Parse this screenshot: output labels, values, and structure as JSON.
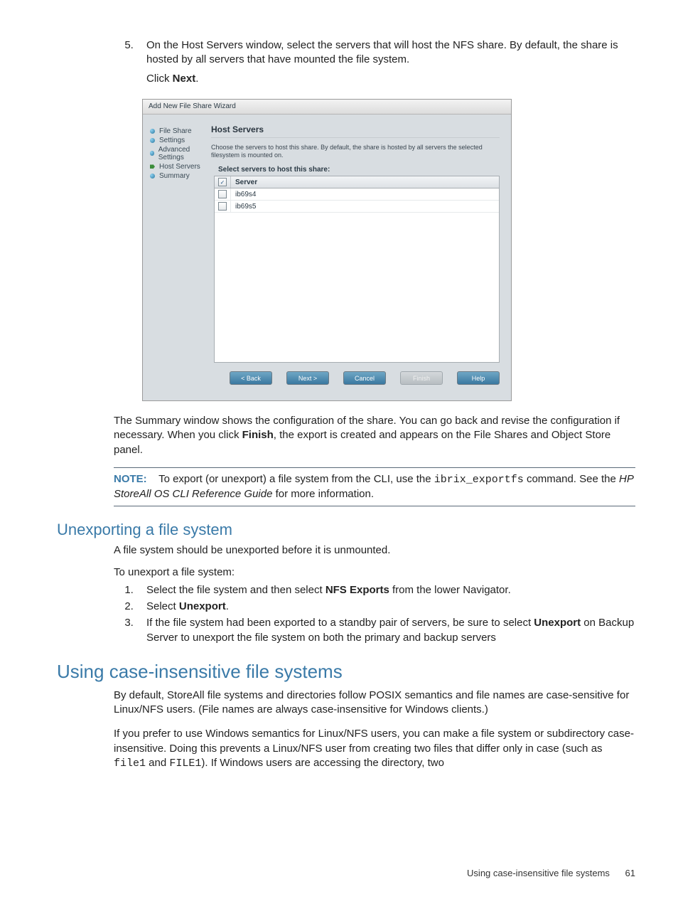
{
  "step5": {
    "num": "5",
    "text_a": "On the Host Servers window, select the servers that will host the NFS share. By default, the share is hosted by all servers that have mounted the file system.",
    "text_b_prefix": "Click ",
    "text_b_bold": "Next",
    "text_b_suffix": "."
  },
  "wizard": {
    "title": "Add New File Share Wizard",
    "nav": {
      "file_share": "File Share",
      "settings": "Settings",
      "advanced": "Advanced Settings",
      "host_servers": "Host Servers",
      "summary": "Summary"
    },
    "main": {
      "heading": "Host Servers",
      "desc": "Choose the servers to host this share. By default, the share is hosted by all servers the selected filesystem is mounted on.",
      "subheading": "Select servers to host this share:",
      "col_server": "Server",
      "rows": [
        {
          "server": "ib69s4"
        },
        {
          "server": "ib69s5"
        }
      ],
      "buttons": {
        "back": "< Back",
        "next": "Next >",
        "cancel": "Cancel",
        "finish": "Finish",
        "help": "Help"
      }
    }
  },
  "summary_para": {
    "a": "The Summary window shows the configuration of the share. You can go back and revise the configuration if necessary. When you click ",
    "b_bold": "Finish",
    "c": ", the export is created and appears on the File Shares and Object Store panel."
  },
  "note": {
    "label": "NOTE:",
    "a": "To export (or unexport) a file system from the CLI, use the ",
    "cmd": "ibrix_exportfs",
    "b": " command. See the ",
    "ref": "HP StoreAll OS CLI Reference Guide",
    "c": " for more information."
  },
  "unexport": {
    "heading": "Unexporting a file system",
    "p1": "A file system should be unexported before it is unmounted.",
    "p2": "To unexport a file system:",
    "steps": {
      "s1_a": "Select the file system and then select ",
      "s1_b_bold": "NFS Exports",
      "s1_c": " from the lower Navigator.",
      "s2_a": "Select ",
      "s2_b_bold": "Unexport",
      "s2_c": ".",
      "s3_a": "If the file system had been exported to a standby pair of servers, be sure to select ",
      "s3_b_bold": "Unexport",
      "s3_c": " on Backup Server to unexport the file system on both the primary and backup servers"
    }
  },
  "caseins": {
    "heading": "Using case-insensitive file systems",
    "p1": "By default, StoreAll file systems and directories follow POSIX semantics and file names are case-sensitive for Linux/NFS users. (File names are always case-insensitive for Windows clients.)",
    "p2_a": "If you prefer to use Windows semantics for Linux/NFS users, you can make a file system or subdirectory case-insensitive. Doing this prevents a Linux/NFS user from creating two files that differ only in case (such as ",
    "p2_code1": "file1",
    "p2_b": " and ",
    "p2_code2": "FILE1",
    "p2_c": "). If Windows users are accessing the directory, two"
  },
  "footer": {
    "text": "Using case-insensitive file systems",
    "page": "61"
  }
}
